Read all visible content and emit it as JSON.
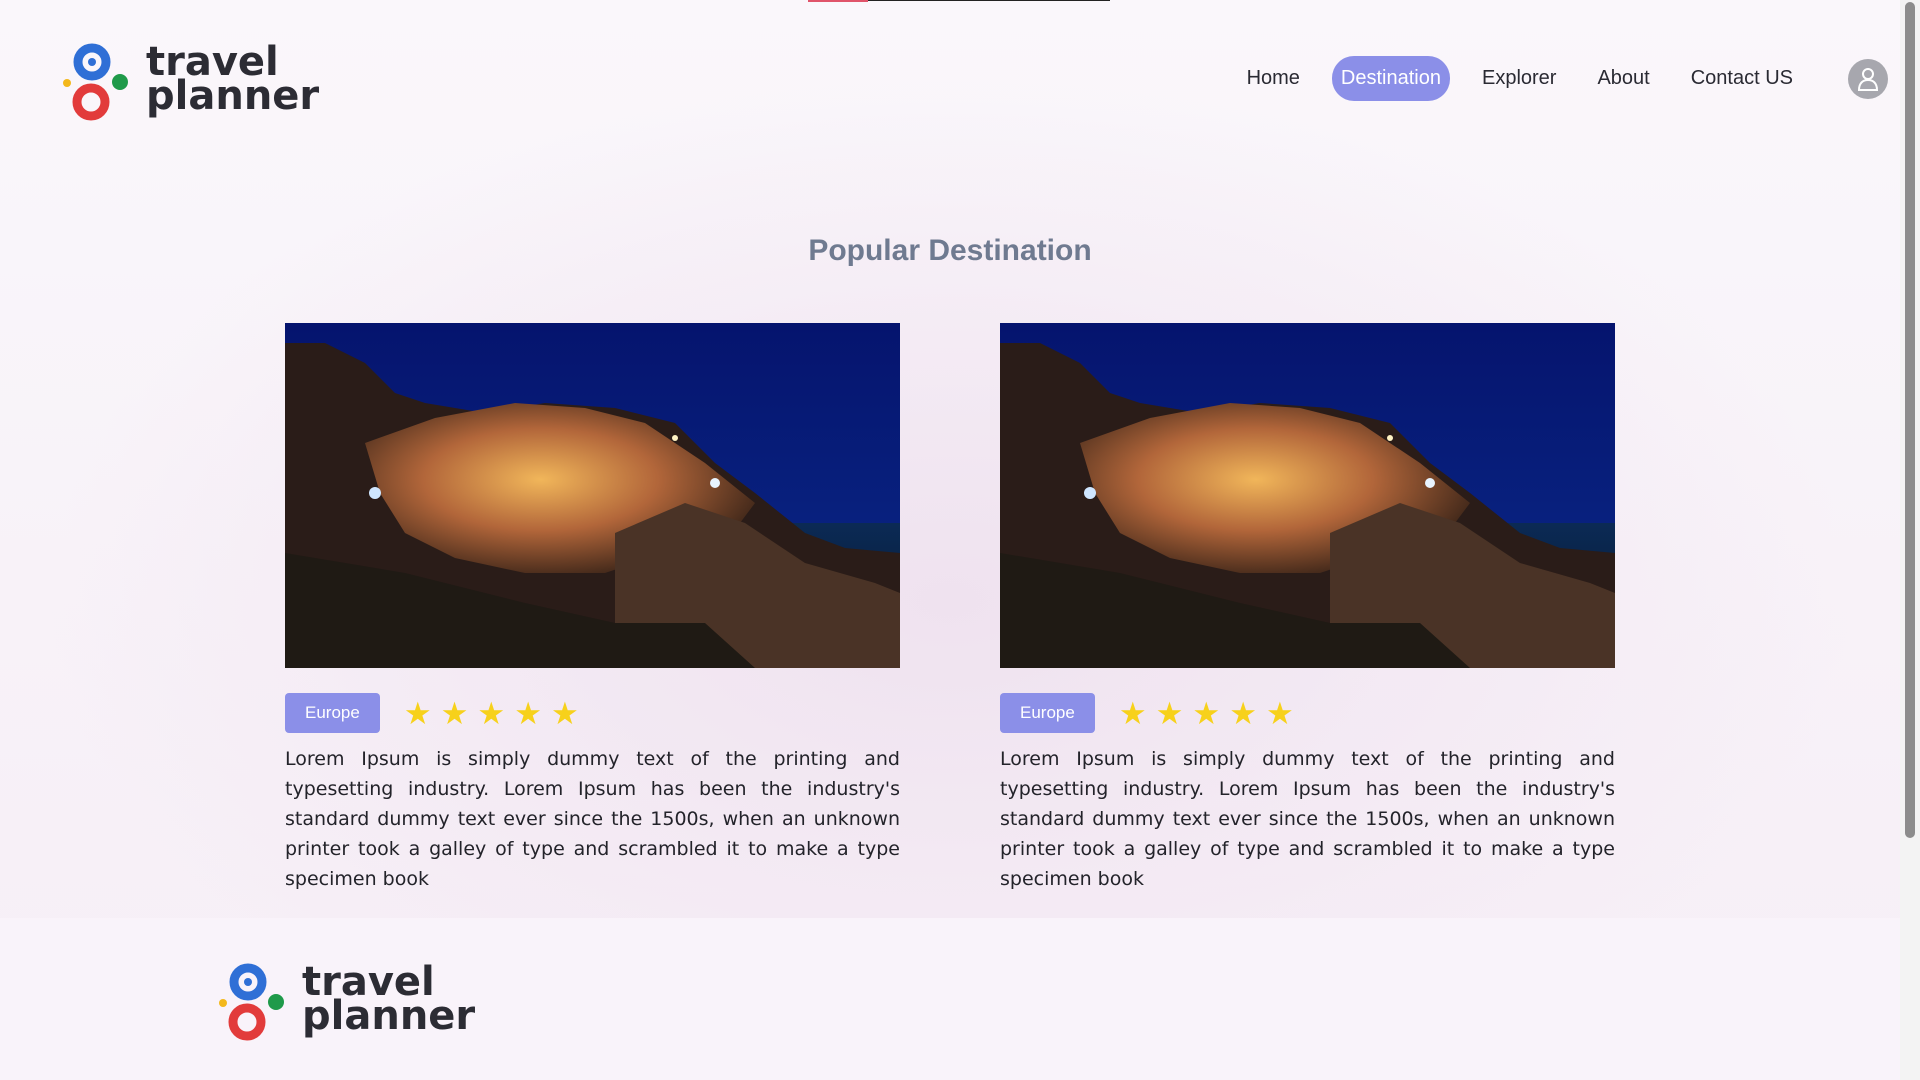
{
  "brand": {
    "line1": "travel",
    "line2": "planner"
  },
  "nav": {
    "items": [
      {
        "label": "Home"
      },
      {
        "label": "Destination",
        "active": true
      },
      {
        "label": "Explorer"
      },
      {
        "label": "About"
      },
      {
        "label": "Contact US"
      }
    ],
    "avatar_icon": "user-icon"
  },
  "section": {
    "title": "Popular Destination"
  },
  "cards": [
    {
      "image_icon": "coastal-village-night-photo",
      "tag": "Europe",
      "rating": 5,
      "description": "Lorem Ipsum is simply dummy text of the printing and typesetting industry. Lorem Ipsum has been the industry's standard dummy text ever since the 1500s, when an unknown printer took a galley of type and scrambled it to make a type specimen book"
    },
    {
      "image_icon": "coastal-village-night-photo",
      "tag": "Europe",
      "rating": 5,
      "description": "Lorem Ipsum is simply dummy text of the printing and typesetting industry. Lorem Ipsum has been the industry's standard dummy text ever since the 1500s, when an unknown printer took a galley of type and scrambled it to make a type specimen book"
    }
  ],
  "footer": {
    "brand_line1": "travel",
    "brand_line2": "planner"
  },
  "colors": {
    "accent": "#8b8fe8",
    "star": "#f7d11b",
    "title": "#6f7a90",
    "logo_blue": "#2f6fd6",
    "logo_red": "#e23b3b",
    "logo_green": "#1f9a4a",
    "logo_yellow": "#f3b81c"
  }
}
